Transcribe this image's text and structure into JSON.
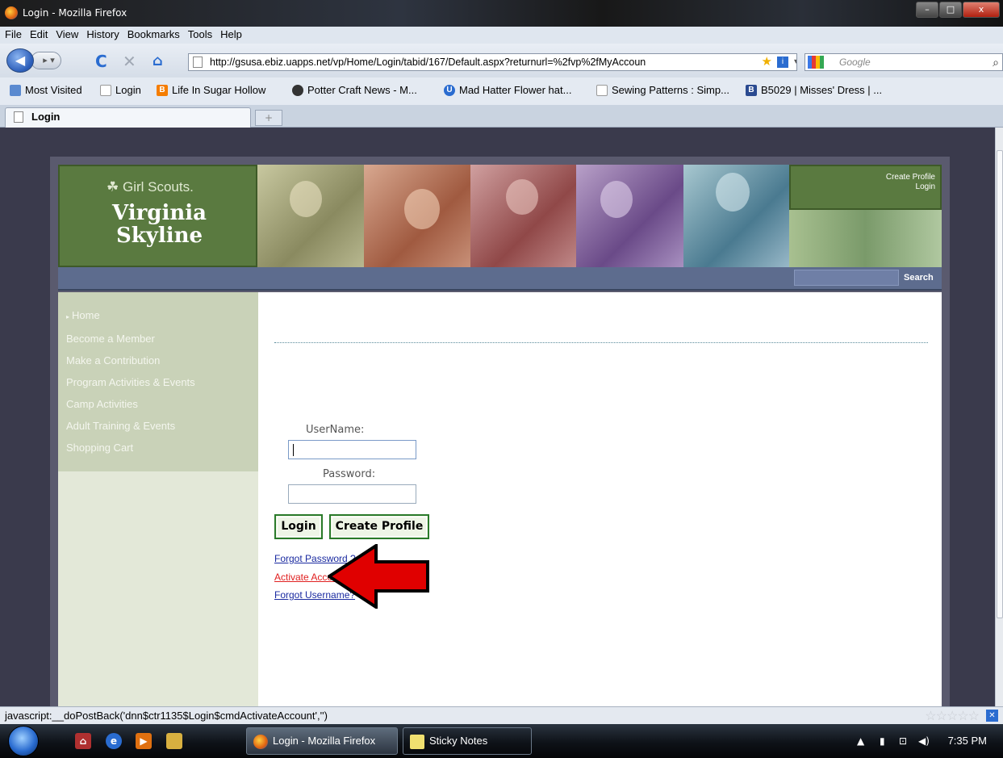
{
  "window": {
    "title": "Login - Mozilla Firefox",
    "buttons": [
      "–",
      "□",
      "x"
    ]
  },
  "menu": [
    "File",
    "Edit",
    "View",
    "History",
    "Bookmarks",
    "Tools",
    "Help"
  ],
  "address": {
    "url": "http://gsusa.ebiz.uapps.net/vp/Home/Login/tabid/167/Default.aspx?returnurl=%2fvp%2fMyAccoun"
  },
  "search": {
    "placeholder": "Google"
  },
  "bookmarks": [
    {
      "label": "Most Visited",
      "icon": "most-visited-icon",
      "color": "#5a8ad0"
    },
    {
      "label": "Login",
      "icon": "page-icon",
      "color": "#ffffff"
    },
    {
      "label": "Life In Sugar Hollow",
      "icon": "blogger-icon",
      "color": "#f57d00"
    },
    {
      "label": "Potter Craft News - M...",
      "icon": "globe-icon",
      "color": "#333333"
    },
    {
      "label": "Mad Hatter Flower hat...",
      "icon": "u-icon",
      "color": "#2a6cd0"
    },
    {
      "label": "Sewing Patterns : Simp...",
      "icon": "page-icon",
      "color": "#ffffff"
    },
    {
      "label": "B5029 | Misses' Dress | ...",
      "icon": "b-icon",
      "color": "#2a4a90"
    }
  ],
  "tab": {
    "label": "Login",
    "new_tab": "+"
  },
  "site": {
    "logo_brand": "Girl Scouts.",
    "logo_line1": "Virginia",
    "logo_line2": "Skyline",
    "create_profile_link": "Create Profile",
    "login_link": "Login",
    "search_button": "Search",
    "nav": [
      "Home",
      "Become a Member",
      "Make a Contribution",
      "Program Activities & Events",
      "Camp Activities",
      "Adult Training & Events",
      "Shopping Cart"
    ]
  },
  "login": {
    "username_label": "UserName:",
    "password_label": "Password:",
    "login_button": "Login",
    "create_profile_button": "Create Profile",
    "forgot_password": "Forgot Password ?",
    "activate_account": "Activate Account",
    "forgot_username": "Forgot Username?"
  },
  "status": {
    "text": "javascript:__doPostBack('dnn$ctr1135$Login$cmdActivateAccount','')"
  },
  "taskbar": {
    "tasks": [
      "Login - Mozilla Firefox",
      "Sticky Notes"
    ],
    "time": "7:35 PM"
  },
  "colors": {
    "arrow": "#e00000",
    "link": "#1a2aa0",
    "active_link": "#e02020",
    "header_green": "#5a7a40"
  }
}
